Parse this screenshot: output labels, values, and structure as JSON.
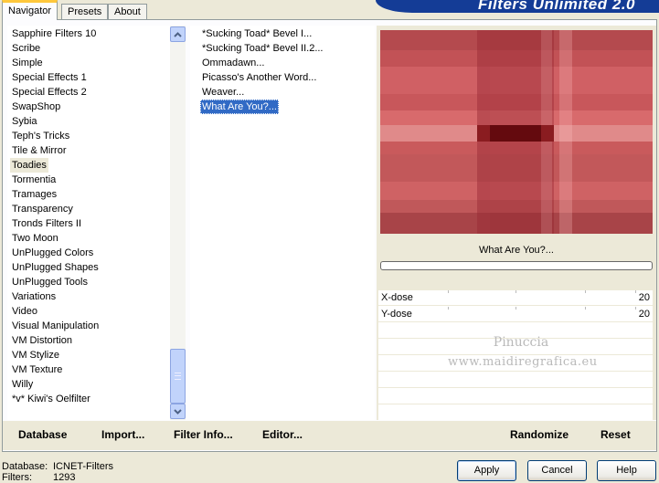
{
  "tabs": [
    {
      "label": "Navigator",
      "active": true
    },
    {
      "label": "Presets",
      "active": false
    },
    {
      "label": "About",
      "active": false
    }
  ],
  "banner": {
    "title": "Filters Unlimited 2.0"
  },
  "categories": {
    "items": [
      "Sapphire Filters 10",
      "Scribe",
      "Simple",
      "Special Effects 1",
      "Special Effects 2",
      "SwapShop",
      "Sybia",
      "Teph's Tricks",
      "Tile & Mirror",
      "Toadies",
      "Tormentia",
      "Tramages",
      "Transparency",
      "Tronds Filters II",
      "Two Moon",
      "UnPlugged Colors",
      "UnPlugged Shapes",
      "UnPlugged Tools",
      "Variations",
      "Video",
      "Visual Manipulation",
      "VM Distortion",
      "VM Stylize",
      "VM Texture",
      "Willy",
      "*v* Kiwi's Oelfilter"
    ],
    "selected": "Toadies"
  },
  "filters": {
    "items": [
      "*Sucking Toad*  Bevel I...",
      "*Sucking Toad*  Bevel II.2...",
      "Ommadawn...",
      "Picasso's Another Word...",
      "Weaver...",
      "What Are You?..."
    ],
    "selected": "What Are You?..."
  },
  "preview": {
    "current_filter": "What Are You?...",
    "progress_percent": 0,
    "base_color": "#c85a5a"
  },
  "parameters": [
    {
      "name": "X-dose",
      "value": "20"
    },
    {
      "name": "Y-dose",
      "value": "20"
    }
  ],
  "watermark": {
    "line1": "Pinuccia",
    "line2": "www.maidiregrafica.eu"
  },
  "toolbar": {
    "database": "Database",
    "import": "Import...",
    "filter_info": "Filter Info...",
    "editor": "Editor...",
    "randomize": "Randomize",
    "reset": "Reset"
  },
  "status": {
    "database_label": "Database:",
    "database_value": "ICNET-Filters",
    "filters_label": "Filters:",
    "filters_value": "1293"
  },
  "buttons": {
    "apply": "Apply",
    "cancel": "Cancel",
    "help": "Help"
  },
  "colors": {
    "selection": "#316ac5",
    "tab_accent": "#ffc83c",
    "banner": "#143c96"
  }
}
